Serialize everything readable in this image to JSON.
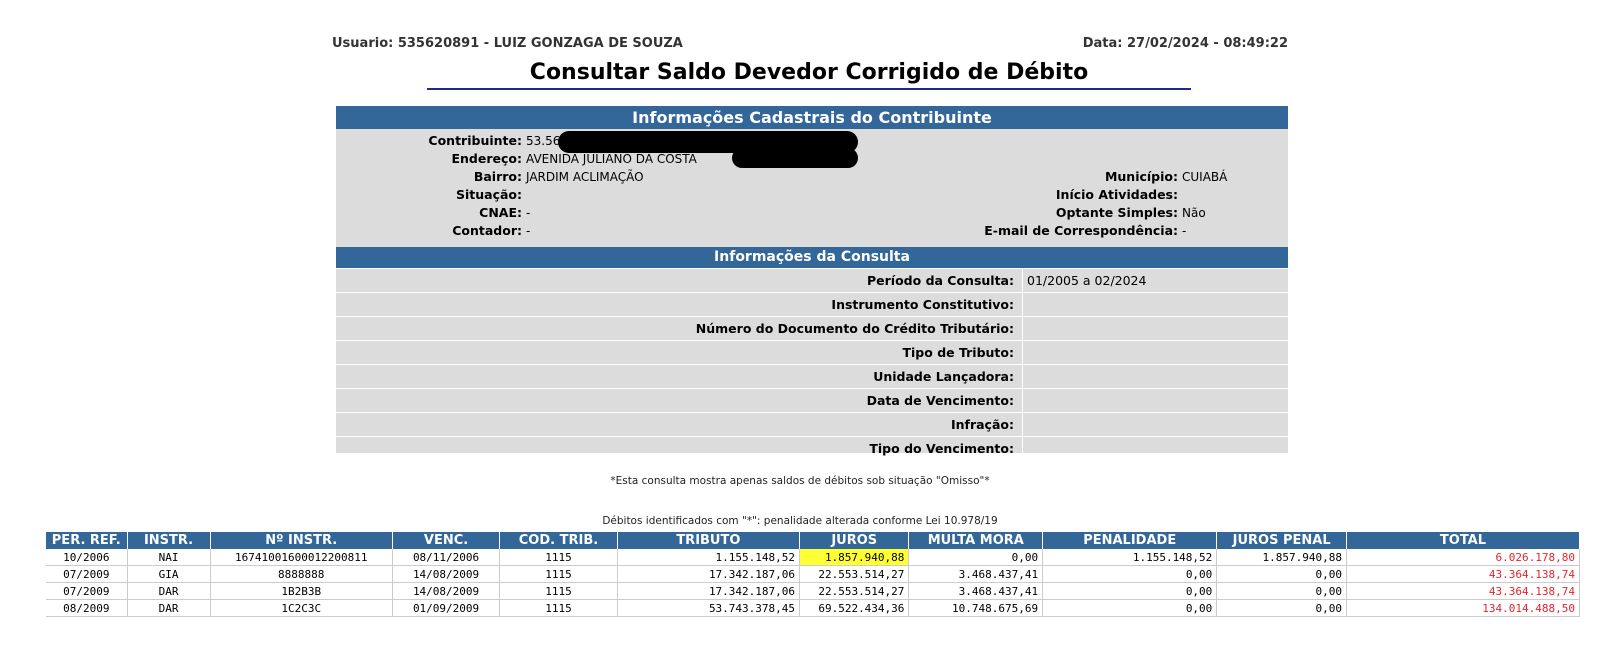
{
  "header": {
    "user": "Usuario: 535620891 - LUIZ GONZAGA DE SOUZA",
    "date": "Data: 27/02/2024 - 08:49:22"
  },
  "page_title": "Consultar Saldo Devedor Corrigido de Débito",
  "cadastro": {
    "heading": "Informações Cadastrais do Contribuinte",
    "contribuinte_label": "Contribuinte:",
    "contribuinte_value": "53.562",
    "endereco_label": "Endereço:",
    "endereco_value": "AVENIDA JULIANO DA COSTA",
    "bairro_label": "Bairro:",
    "bairro_value": "JARDIM ACLIMAÇÃO",
    "situacao_label": "Situação:",
    "situacao_value": "",
    "cnae_label": "CNAE:",
    "cnae_value": "-",
    "contador_label": "Contador:",
    "contador_value": "-",
    "municipio_label": "Município:",
    "municipio_value": "CUIABÁ",
    "inicio_label": "Início Atividades:",
    "inicio_value": "",
    "optante_label": "Optante Simples:",
    "optante_value": "Não",
    "email_label": "E-mail de Correspondência:",
    "email_value": "-"
  },
  "consulta": {
    "heading": "Informações da Consulta",
    "rows": [
      {
        "label": "Período da Consulta:",
        "value": "01/2005 a 02/2024"
      },
      {
        "label": "Instrumento Constitutivo:",
        "value": ""
      },
      {
        "label": "Número do Documento do Crédito Tributário:",
        "value": ""
      },
      {
        "label": "Tipo de Tributo:",
        "value": ""
      },
      {
        "label": "Unidade Lançadora:",
        "value": ""
      },
      {
        "label": "Data de Vencimento:",
        "value": ""
      },
      {
        "label": "Infração:",
        "value": ""
      },
      {
        "label": "Tipo do Vencimento:",
        "value": ""
      }
    ]
  },
  "notes": {
    "omisso": "*Esta consulta mostra apenas saldos de débitos sob situação \"Omisso\"*",
    "lei": "Débitos identificados com \"*\": penalidade alterada conforme Lei 10.978/19"
  },
  "table": {
    "columns": [
      "PER. REF.",
      "INSTR.",
      "Nº INSTR.",
      "VENC.",
      "COD. TRIB.",
      "TRIBUTO",
      "JUROS",
      "MULTA MORA",
      "PENALIDADE",
      "JUROS PENAL",
      "TOTAL"
    ],
    "rows": [
      [
        "10/2006",
        "NAI",
        "16741001600012200811",
        "08/11/2006",
        "1115",
        "1.155.148,52",
        "1.857.940,88",
        "0,00",
        "1.155.148,52",
        "1.857.940,88",
        "6.026.178,80"
      ],
      [
        "07/2009",
        "GIA",
        "8888888",
        "14/08/2009",
        "1115",
        "17.342.187,06",
        "22.553.514,27",
        "3.468.437,41",
        "0,00",
        "0,00",
        "43.364.138,74"
      ],
      [
        "07/2009",
        "DAR",
        "1B2B3B",
        "14/08/2009",
        "1115",
        "17.342.187,06",
        "22.553.514,27",
        "3.468.437,41",
        "0,00",
        "0,00",
        "43.364.138,74"
      ],
      [
        "08/2009",
        "DAR",
        "1C2C3C",
        "01/09/2009",
        "1115",
        "53.743.378,45",
        "69.522.434,36",
        "10.748.675,69",
        "0,00",
        "0,00",
        "134.014.488,50"
      ]
    ]
  },
  "colors": {
    "header_blue": "#336699",
    "panel_gray": "#dcdcdc",
    "total_red": "#e8232c",
    "highlight_yellow": "#ffff33"
  }
}
